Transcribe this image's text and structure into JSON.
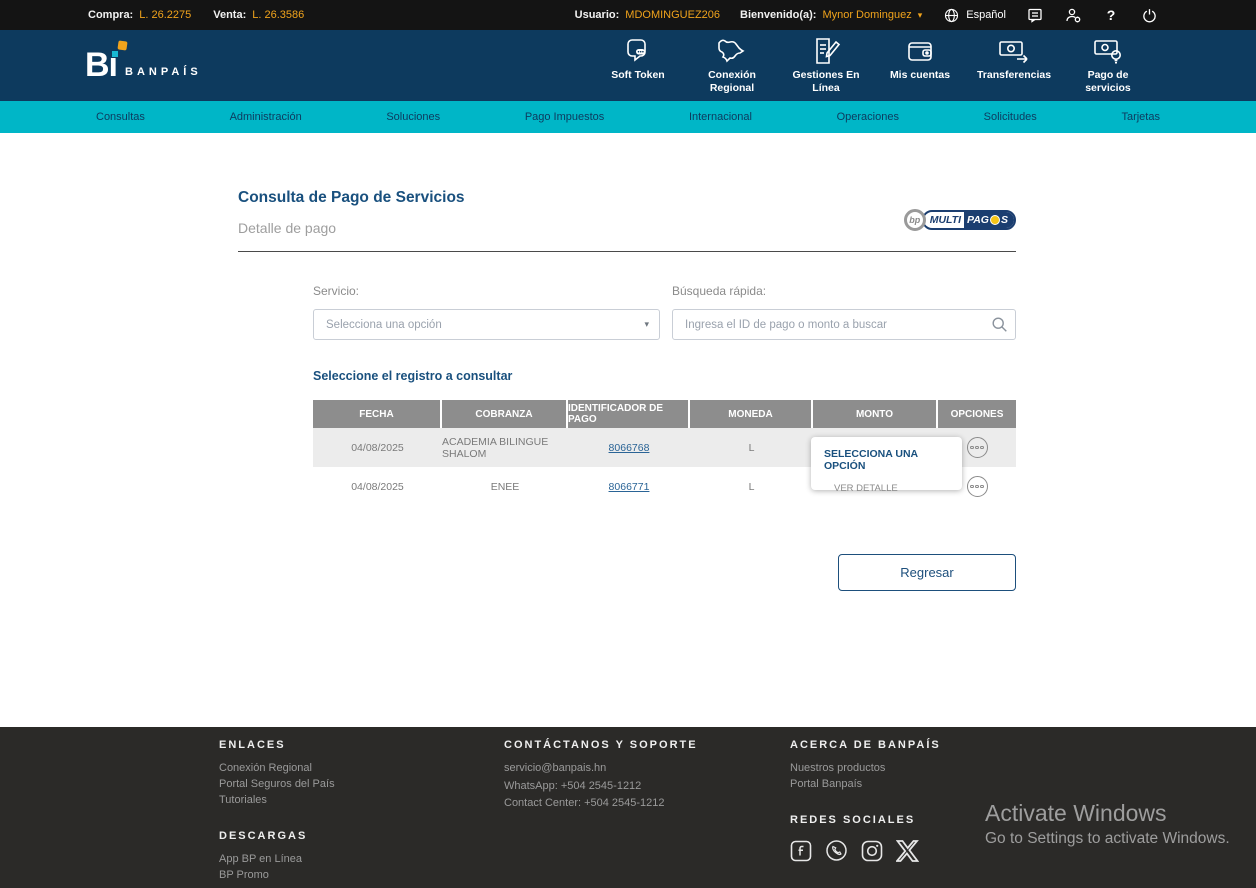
{
  "colors": {
    "navy": "#0d3a5e",
    "teal": "#00b6c7",
    "orange": "#f0a31c",
    "title_blue": "#19507e",
    "link_blue": "#2a6496",
    "table_header_gray": "#8d8d8d",
    "footer_bg": "#2b2a28"
  },
  "icons": {
    "caret_down": "▾",
    "help": "?",
    "x_logo": "X"
  },
  "topbar": {
    "compra_label": "Compra:",
    "compra_value": "L. 26.2275",
    "venta_label": "Venta:",
    "venta_value": "L. 26.3586",
    "usuario_label": "Usuario:",
    "usuario_value": "MDOMINGUEZ206",
    "bienvenido_label": "Bienvenido(a):",
    "bienvenido_value": "Mynor Dominguez",
    "language": "Español"
  },
  "brand": {
    "logo_text": "Bı",
    "name": "BANPAÍS"
  },
  "navbar": {
    "items": [
      {
        "label": "Soft Token"
      },
      {
        "label": "Conexión Regional"
      },
      {
        "label": "Gestiones En Línea"
      },
      {
        "label": "Mis cuentas"
      },
      {
        "label": "Transferencias"
      },
      {
        "label": "Pago de servicios"
      }
    ]
  },
  "menubar": {
    "items": [
      {
        "label": "Consultas"
      },
      {
        "label": "Administración"
      },
      {
        "label": "Soluciones"
      },
      {
        "label": "Pago Impuestos"
      },
      {
        "label": "Internacional"
      },
      {
        "label": "Operaciones"
      },
      {
        "label": "Solicitudes"
      },
      {
        "label": "Tarjetas"
      }
    ]
  },
  "main": {
    "title": "Consulta de Pago de Servicios",
    "subtitle": "Detalle de pago",
    "multipagos": {
      "bp": "bp",
      "multi": "MULTI",
      "pag": "PAG",
      "s": "S"
    },
    "form": {
      "servicio_label": "Servicio:",
      "servicio_placeholder": "Selecciona una opción",
      "busqueda_label": "Búsqueda rápida:",
      "busqueda_placeholder": "Ingresa el ID de pago o monto a buscar"
    },
    "section_title": "Seleccione el registro a consultar",
    "table": {
      "columns": [
        "FECHA",
        "COBRANZA",
        "IDENTIFICADOR DE PAGO",
        "MONEDA",
        "MONTO",
        "OPCIONES"
      ],
      "rows": [
        {
          "fecha": "04/08/2025",
          "cobranza": "ACADEMIA BILINGUE SHALOM",
          "id_pago": "8066768",
          "moneda": "L",
          "monto": ""
        },
        {
          "fecha": "04/08/2025",
          "cobranza": "ENEE",
          "id_pago": "8066771",
          "moneda": "L",
          "monto": ""
        }
      ]
    },
    "popup": {
      "title": "SELECCIONA UNA OPCIÓN",
      "option": "VER DETALLE"
    },
    "back_button": "Regresar"
  },
  "footer": {
    "enlaces": {
      "heading": "ENLACES",
      "links": [
        "Conexión Regional",
        "Portal Seguros del País",
        "Tutoriales"
      ]
    },
    "descargas": {
      "heading": "DESCARGAS",
      "links": [
        "App BP en Línea",
        "BP Promo"
      ]
    },
    "contacto": {
      "heading": "CONTÁCTANOS Y SOPORTE",
      "lines": [
        "servicio@banpais.hn",
        "WhatsApp: +504 2545-1212",
        "Contact Center: +504 2545-1212"
      ]
    },
    "acerca": {
      "heading": "ACERCA DE BANPAÍS",
      "links": [
        "Nuestros productos",
        "Portal Banpaís"
      ]
    },
    "redes_heading": "REDES SOCIALES",
    "watermark": {
      "line1": "Activate Windows",
      "line2": "Go to Settings to activate Windows."
    }
  }
}
